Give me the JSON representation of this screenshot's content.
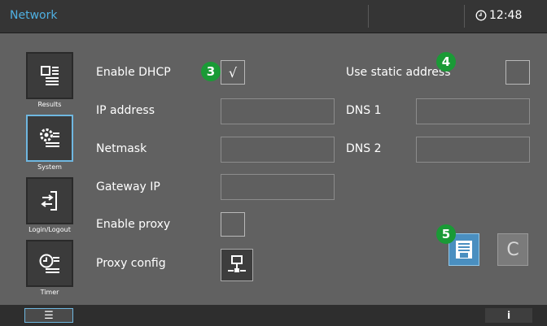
{
  "header": {
    "title": "Network",
    "time": "12:48",
    "clock_icon": "clock-icon"
  },
  "sidebar": {
    "items": [
      {
        "label": "Results",
        "icon": "results-icon",
        "active": false
      },
      {
        "label": "System",
        "icon": "system-icon",
        "active": true
      },
      {
        "label": "Login/Logout",
        "icon": "login-logout-icon",
        "active": false
      },
      {
        "label": "Timer",
        "icon": "timer-icon",
        "active": false
      }
    ]
  },
  "form": {
    "enable_dhcp": {
      "label": "Enable DHCP",
      "checked": true,
      "check_glyph": "√"
    },
    "ip_address": {
      "label": "IP address",
      "value": ""
    },
    "netmask": {
      "label": "Netmask",
      "value": ""
    },
    "gateway_ip": {
      "label": "Gateway IP",
      "value": ""
    },
    "enable_proxy": {
      "label": "Enable proxy",
      "checked": false
    },
    "proxy_config": {
      "label": "Proxy config",
      "icon": "network-config-icon"
    },
    "use_static_address": {
      "label": "Use static address",
      "checked": false
    },
    "dns1": {
      "label": "DNS 1",
      "value": ""
    },
    "dns2": {
      "label": "DNS 2",
      "value": ""
    }
  },
  "badges": {
    "b3": "3",
    "b4": "4",
    "b5": "5"
  },
  "actions": {
    "save_icon": "save-icon",
    "cancel_label": "C"
  },
  "footer": {
    "menu_glyph": "☰",
    "info_label": "i"
  },
  "colors": {
    "title_accent": "#4fb0e2",
    "badge_green": "#1a9a36",
    "active_border": "#6fb7e0",
    "save_button": "#4a8fc0"
  }
}
